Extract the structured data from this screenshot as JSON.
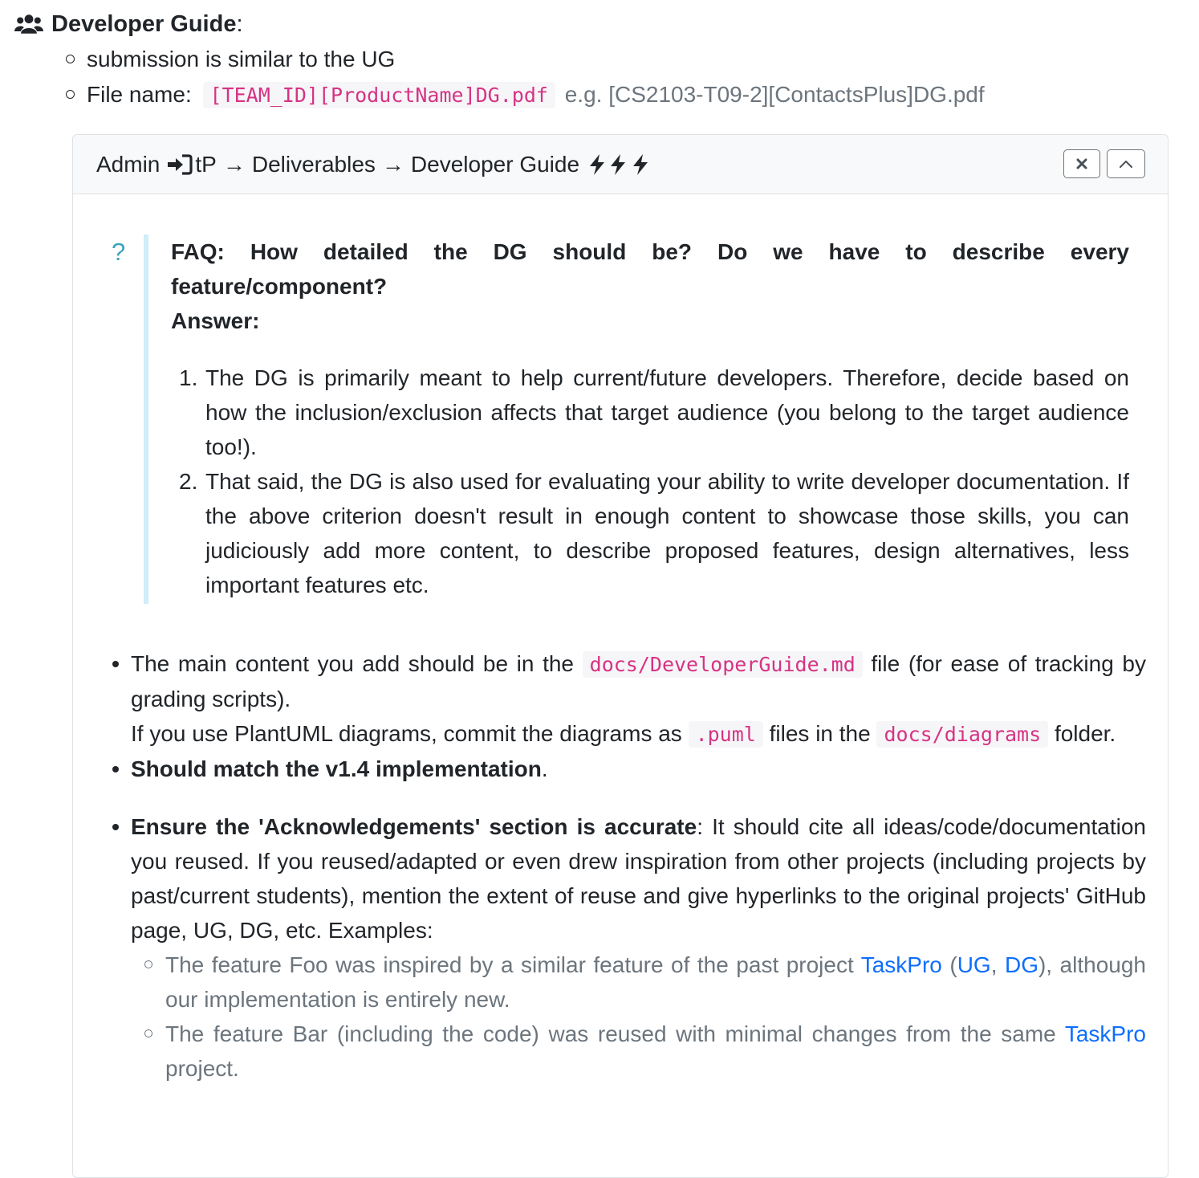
{
  "heading": {
    "icon": "users-icon",
    "title": "Developer Guide",
    "suffix": ":"
  },
  "sub_items": [
    {
      "text": "submission is similar to the UG"
    },
    {
      "label": "File name:",
      "code": "[TEAM_ID][ProductName]DG.pdf",
      "example": "e.g. [CS2103-T09-2][ContactsPlus]DG.pdf"
    }
  ],
  "panel": {
    "breadcrumb": {
      "admin": "Admin",
      "admin_icon": "sign-in-icon",
      "tp": "tP",
      "arrow": "→",
      "deliverables": "Deliverables",
      "developer_guide": "Developer Guide",
      "bolt_icons": [
        "bolt-icon",
        "bolt-icon",
        "bolt-icon"
      ]
    },
    "close_icon": "close-icon",
    "collapse_icon": "chevron-up-icon"
  },
  "faq": {
    "icon": "?",
    "question_line1": "FAQ: How detailed the DG should be? Do we have to describe every",
    "question_line2": "feature/component?",
    "answer_label": "Answer:",
    "answers": [
      {
        "num": "1.",
        "text": "The DG is primarily meant to help current/future developers. Therefore, decide based on how the inclusion/exclusion affects that target audience (you belong to the target audience too!)."
      },
      {
        "num": "2.",
        "text": "That said, the DG is also used for evaluating your ability to write developer documentation. If the above criterion doesn't result in enough content to showcase those skills, you can judiciously add more content, to describe proposed features, design alternatives, less important features etc."
      }
    ]
  },
  "bullets": {
    "b1": {
      "pre": "The main content you add should be in the",
      "code": "docs/DeveloperGuide.md",
      "post": "file (for ease of tracking by grading scripts).",
      "l2_pre": "If you use PlantUML diagrams, commit the diagrams as",
      "l2_code1": ".puml",
      "l2_mid": "files in the",
      "l2_code2": "docs/diagrams",
      "l2_post": "folder."
    },
    "b2": {
      "bold": "Should match the v1.4 implementation",
      "post": "."
    },
    "b3": {
      "bold": "Ensure the 'Acknowledgements' section is accurate",
      "post": ": It should cite all ideas/code/documentation you reused. If you reused/adapted or even drew inspiration from other projects (including projects by past/current students), mention the extent of reuse and give hyperlinks to the original projects' GitHub page, UG, DG, etc. Examples:",
      "examples": [
        {
          "pre": "The feature Foo was inspired by a similar feature of the past project",
          "link1": "TaskPro",
          "paren_open": " (",
          "link2": "UG",
          "comma": ", ",
          "link3": "DG",
          "post": "), although our implementation is entirely new."
        },
        {
          "pre": "The feature Bar (including the code) was reused with minimal changes from the same",
          "link1": "TaskPro",
          "post": "project."
        }
      ]
    }
  },
  "colors": {
    "code_text": "#d63384",
    "code_bg": "#f6f6f8",
    "link": "#0d6efd",
    "faq_border": "#cfeef7",
    "faq_icon": "#3aa2bd",
    "muted": "#6c757d"
  }
}
